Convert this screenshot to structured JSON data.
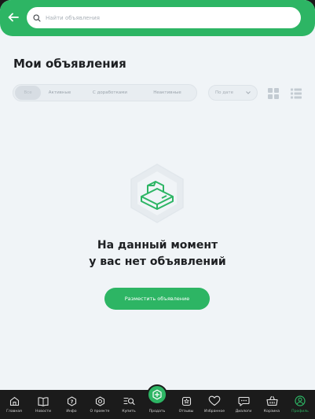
{
  "search": {
    "placeholder": "Найти объявления"
  },
  "page": {
    "title": "Мои объявления"
  },
  "filters": [
    "Все",
    "Активные",
    "С доработками",
    "Неактивные"
  ],
  "sort": {
    "label": "По дате"
  },
  "empty": {
    "line1": "На данный момент",
    "line2": "у вас нет объявлений"
  },
  "cta": {
    "label": "Разместить объявление"
  },
  "nav": {
    "home": "Главная",
    "news": "Новости",
    "info": "Инфо",
    "about": "О проекте",
    "buy": "Купить",
    "sell": "Продать",
    "reviews": "Отзывы",
    "favorites": "Избранное",
    "dialogs": "Диалоги",
    "cart": "Корзина",
    "profile": "Профиль"
  },
  "colors": {
    "accent": "#2db564",
    "background": "#f0f4f7",
    "nav": "#1b1b1b"
  }
}
